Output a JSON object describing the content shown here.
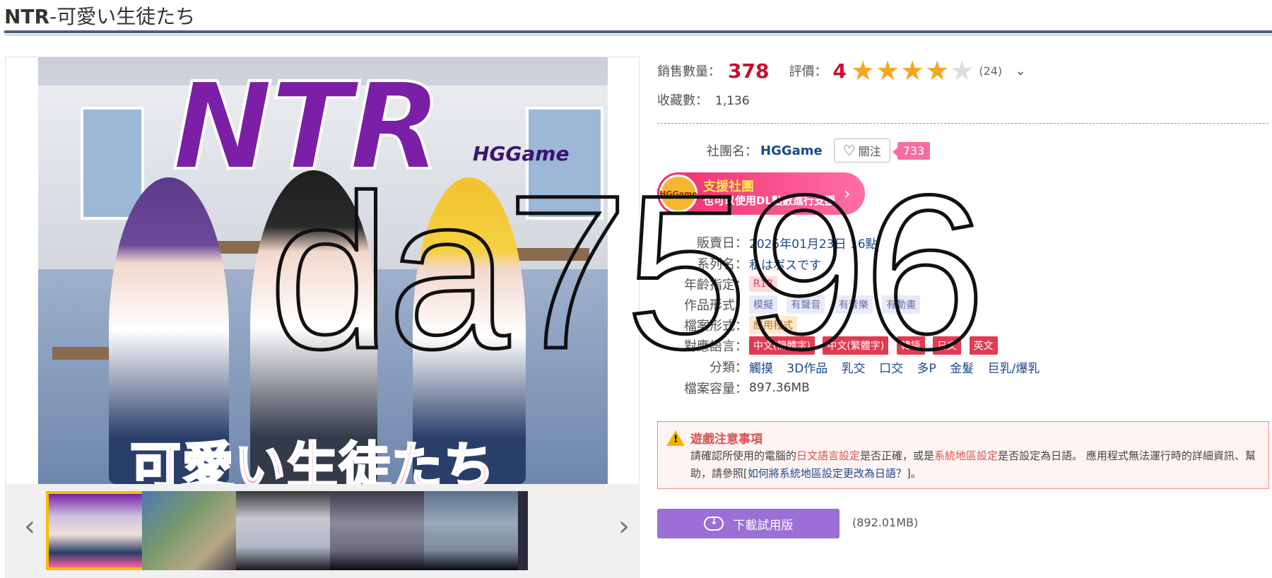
{
  "page": {
    "title_prefix": "NTR",
    "title_rest": "-可愛い生徒たち"
  },
  "gallery": {
    "main_image": {
      "logo_text": "NTR",
      "brand_text": "HGGame",
      "subtitle_text": "可愛い生徒たち"
    },
    "prev_label": "‹",
    "next_label": "›",
    "thumbnails": [
      {
        "selected": true
      },
      {
        "selected": false
      },
      {
        "selected": false
      },
      {
        "selected": false
      },
      {
        "selected": false
      }
    ]
  },
  "stats": {
    "sales_label": "銷售數量：",
    "sales_value": "378",
    "rating_label": "評價：",
    "rating_value": "4",
    "rating_stars": 4,
    "rating_max": 5,
    "rating_count": "(24)",
    "favorites_label": "收藏數：",
    "favorites_value": "1,136"
  },
  "circle": {
    "label": "社團名：",
    "name": "HGGame",
    "follow_label": "關注",
    "follow_count": "733"
  },
  "support": {
    "avatar_text": "HGGame",
    "title": "支援社團",
    "subtitle": "也可以使用DL點數進行支援"
  },
  "specs": {
    "release_label": "販賣日：",
    "release_value": "2025年01月23日 16點",
    "series_label": "系列名：",
    "series_value": "私はボスです",
    "age_label": "年齡指定：",
    "age_value": "R18",
    "format_label": "作品形式：",
    "format_tags": [
      "模擬",
      "有聲音",
      "有音樂",
      "有動畫"
    ],
    "file_label": "檔案形式：",
    "file_value": "應用程式",
    "lang_label": "對應語言：",
    "lang_tags": [
      "中文(簡體字)",
      "中文(繁體字)",
      "韓語",
      "日文",
      "英文"
    ],
    "genre_label": "分類：",
    "genres": [
      "觸摸",
      "3D作品",
      "乳交",
      "口交",
      "多P",
      "金髮",
      "巨乳/爆乳"
    ],
    "size_label": "檔案容量：",
    "size_value": "897.36MB"
  },
  "notice": {
    "title": "遊戲注意事項",
    "body_1": "請確認所使用的電腦的",
    "body_red_1": "日文語言設定",
    "body_2": "是否正確，或是",
    "body_red_2": "系統地區設定",
    "body_3": "是否設定為日語。 應用程式無法運行時的詳細資訊、幫助，請參照[",
    "body_link": "如何將系統地區設定更改為日語？",
    "body_4": "]。"
  },
  "download": {
    "button_label": "下載試用版",
    "size": "(892.01MB)"
  },
  "watermark": {
    "text": "da7596"
  },
  "colors": {
    "accent_red": "#c8102e",
    "star": "#f5a623",
    "download": "#9b6fd6",
    "support": "#ef2c6e"
  }
}
